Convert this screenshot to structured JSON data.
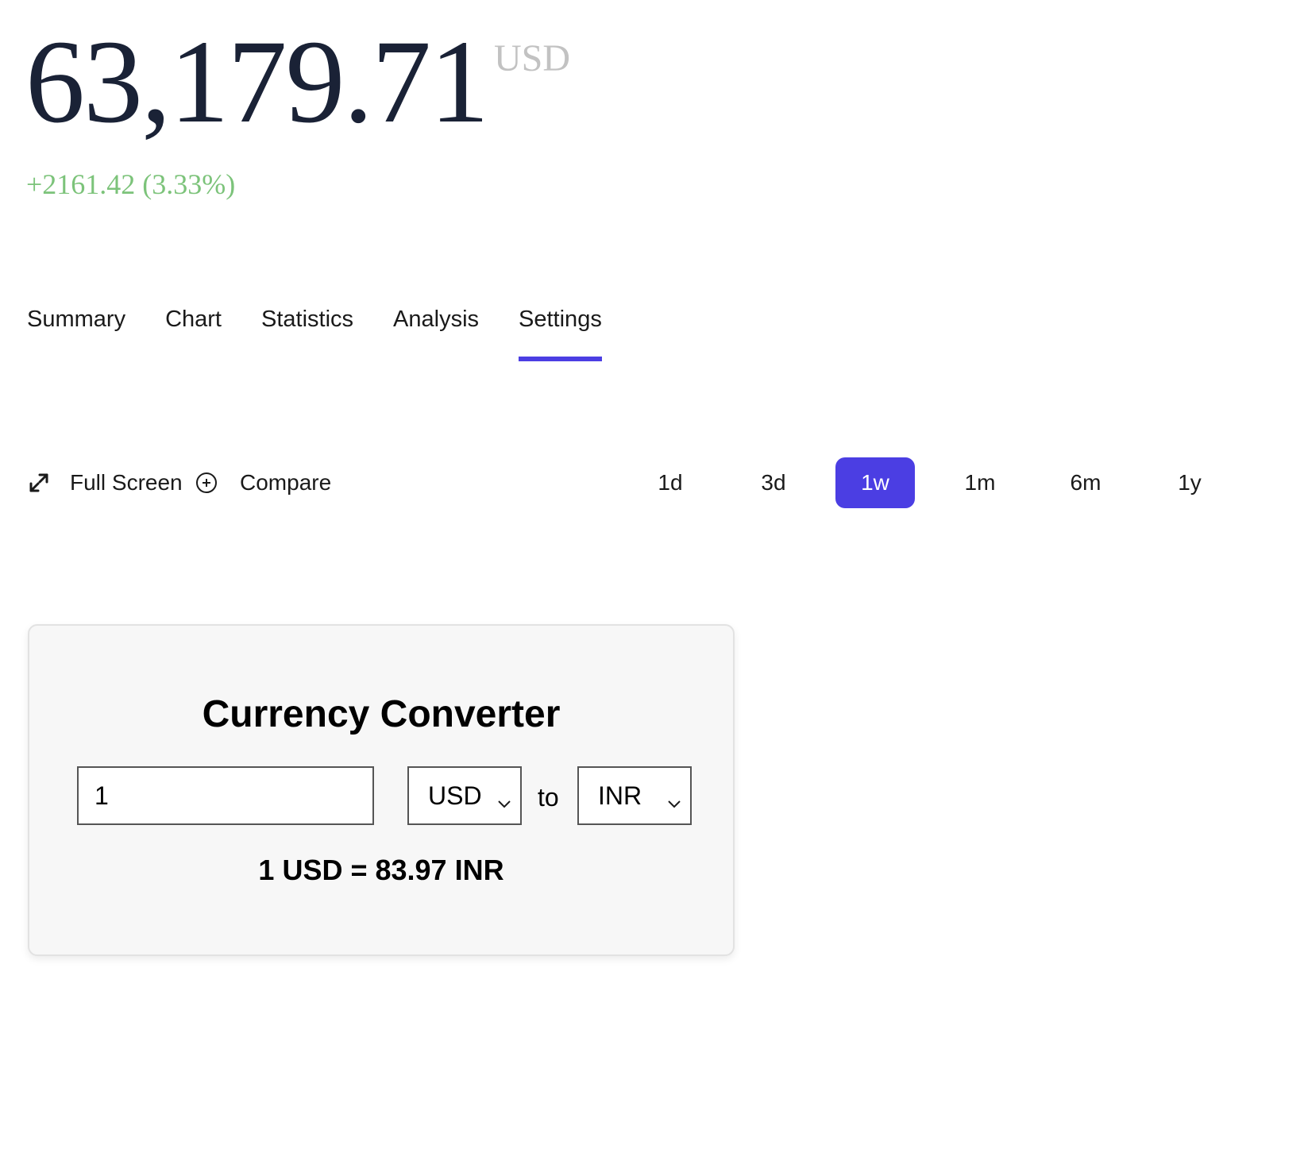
{
  "header": {
    "price": "63,179.71",
    "currency": "USD",
    "change": "+2161.42 (3.33%)",
    "change_color": "#7cc37a"
  },
  "tabs": [
    {
      "label": "Summary",
      "active": false
    },
    {
      "label": "Chart",
      "active": false
    },
    {
      "label": "Statistics",
      "active": false
    },
    {
      "label": "Analysis",
      "active": false
    },
    {
      "label": "Settings",
      "active": true
    }
  ],
  "toolbar": {
    "fullscreen_label": "Full Screen",
    "fullscreen_icon": "expand-arrows-icon",
    "compare_label": "Compare",
    "compare_icon": "plus-circle-icon",
    "ranges": [
      "1d",
      "3d",
      "1w",
      "1m",
      "6m",
      "1y"
    ],
    "active_range": "1w",
    "accent_color": "#4b3ee3"
  },
  "converter": {
    "title": "Currency Converter",
    "amount": "1",
    "from_currency": "USD",
    "to_label": "to",
    "to_currency": "INR",
    "result": "1 USD = 83.97 INR"
  }
}
